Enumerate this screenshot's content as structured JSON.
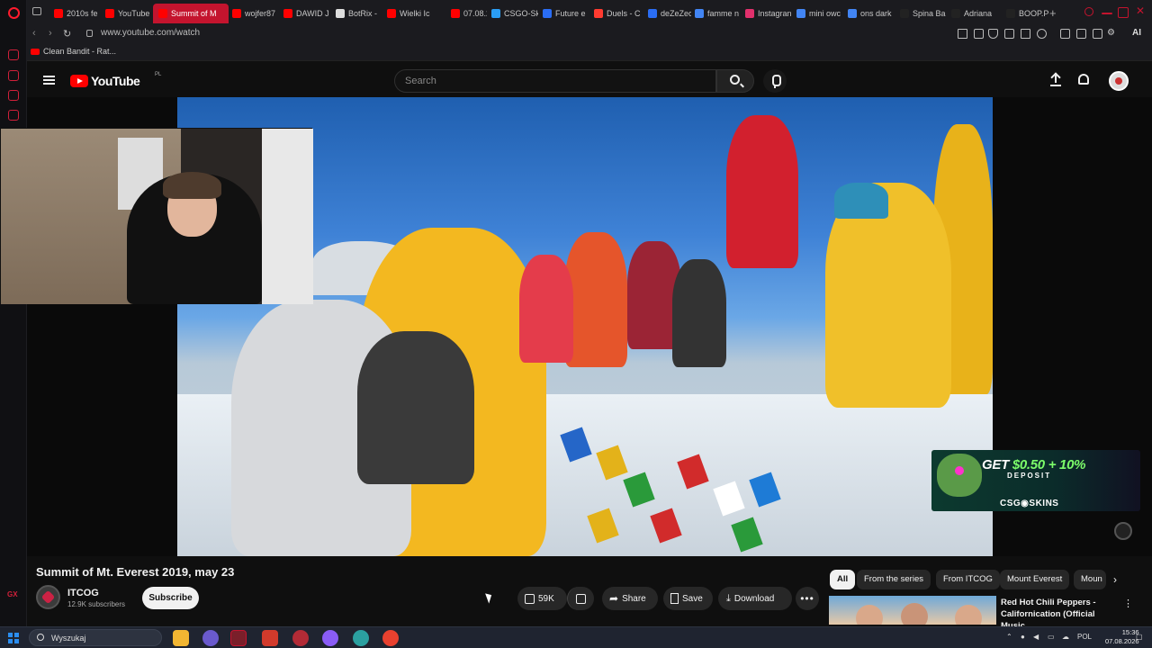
{
  "browser": {
    "tabs": [
      {
        "label": "2010s fe",
        "color": "#ff0000"
      },
      {
        "label": "YouTube",
        "color": "#ff0000"
      },
      {
        "label": "Summit of M",
        "color": "#ff0000",
        "active": true
      },
      {
        "label": "wojfer87",
        "color": "#ff0000"
      },
      {
        "label": "DAWID J",
        "color": "#ff0000"
      },
      {
        "label": "BotRix -",
        "color": "#dddddd"
      },
      {
        "label": "Wielki Ic",
        "color": "#ff0000"
      },
      {
        "label": "07.08.20",
        "color": "#ff0000"
      },
      {
        "label": "CSGO-Sk",
        "color": "#2a9df4"
      },
      {
        "label": "Future e",
        "color": "#2a6df4"
      },
      {
        "label": "Duels - C",
        "color": "#ff3b30"
      },
      {
        "label": "deZeZec",
        "color": "#2a6df4"
      },
      {
        "label": "famme n",
        "color": "#4285f4"
      },
      {
        "label": "Instagran",
        "color": "#e1306c"
      },
      {
        "label": "mini owc",
        "color": "#4285f4"
      },
      {
        "label": "ons dark",
        "color": "#4285f4"
      },
      {
        "label": "Spina Ba",
        "color": "#222222"
      },
      {
        "label": "Adriana",
        "color": "#222222"
      },
      {
        "label": "BOOP.PL",
        "color": "#222222"
      }
    ],
    "new_tab_symbol": "+",
    "url": "www.youtube.com/watch",
    "ai_label": "AI",
    "bookmark": "Clean Bandit - Rat..."
  },
  "youtube": {
    "logo_text": "YouTube",
    "country_code": "PL",
    "search_placeholder": "Search",
    "video": {
      "title": "Summit of Mt. Everest 2019, may 23",
      "channel": "ITCOG",
      "subscribers": "12.9K subscribers",
      "subscribe_label": "Subscribe",
      "likes": "59K",
      "share_label": "Share",
      "save_label": "Save",
      "download_label": "Download"
    },
    "ad": {
      "line1_prefix": "GET",
      "line1_value": "$0.50 + 10%",
      "line2": "DEPOSIT",
      "brand": "CSG◉SKINS"
    },
    "chips": [
      "All",
      "From the series",
      "From ITCOG",
      "Mount Everest",
      "Moun"
    ],
    "recommendation": {
      "title": "Red Hot Chili Peppers - Californication (Official Music..."
    }
  },
  "taskbar": {
    "search_placeholder": "Wyszukaj",
    "language": "POL",
    "time": "15:36",
    "date": "07.08.2026"
  }
}
